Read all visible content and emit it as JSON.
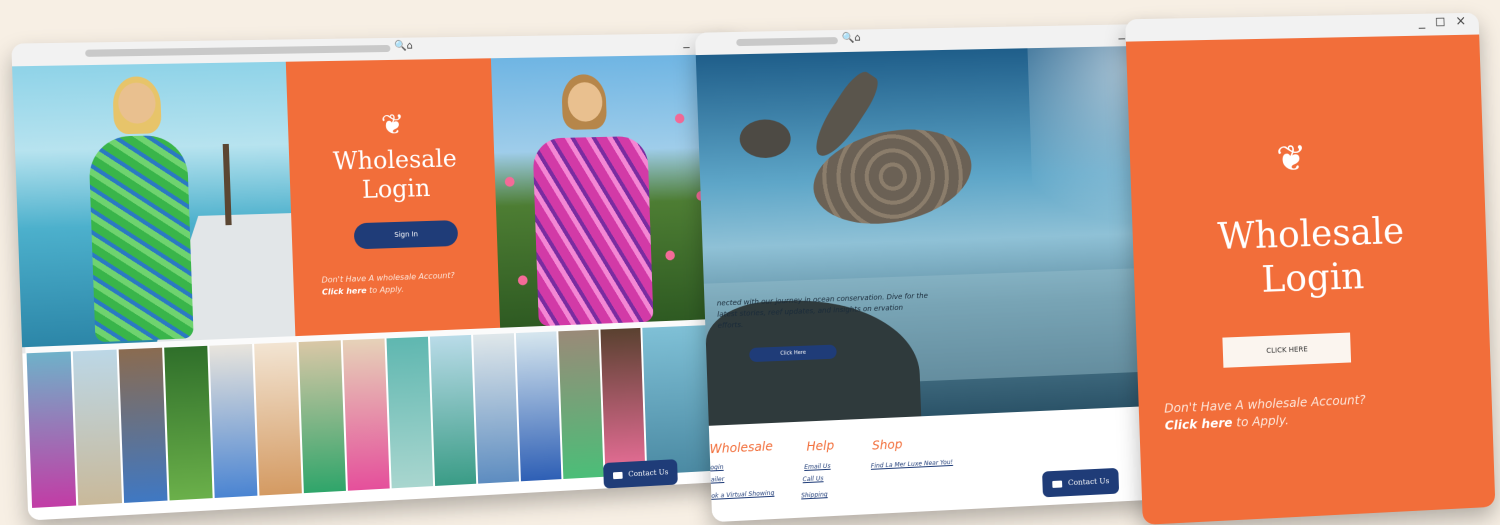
{
  "window_controls": "_ ◻ ×",
  "browser_icons": "🔍⌂",
  "login_panel": {
    "title_line1": "Wholesale",
    "title_line2": "Login",
    "sign_in_label": "Sign In",
    "no_account_text": "Don't Have A wholesale Account?",
    "click_here_bold": "Click here",
    "to_apply": " to Apply."
  },
  "contact_label": "Contact Us",
  "ocean_page": {
    "intro_text": "nected with our journey in ocean conservation. Dive for the latest stories, reef updates, and insights on ervation efforts.",
    "button_label": "Click Here",
    "footer": {
      "col_wholesale": "Wholesale",
      "wholesale_links": [
        "ogin",
        "ailer",
        "ok a Virtual Showing"
      ],
      "col_help": "Help",
      "help_links": [
        "Email Us",
        "Call Us",
        "Shipping"
      ],
      "col_shop": "Shop",
      "shop_links": [
        "Find La Mer Luxe Near You!"
      ]
    }
  },
  "login_page_large": {
    "title_line1": "Wholesale",
    "title_line2": "Login",
    "button_label": "CLICK HERE",
    "no_account_text": "Don't Have A wholesale Account?",
    "click_here_bold": "Click here",
    "to_apply": " to Apply."
  },
  "colors": {
    "brand_orange": "#f26e3a",
    "brand_navy": "#1f3c78",
    "background_cream": "#f7efe4"
  }
}
